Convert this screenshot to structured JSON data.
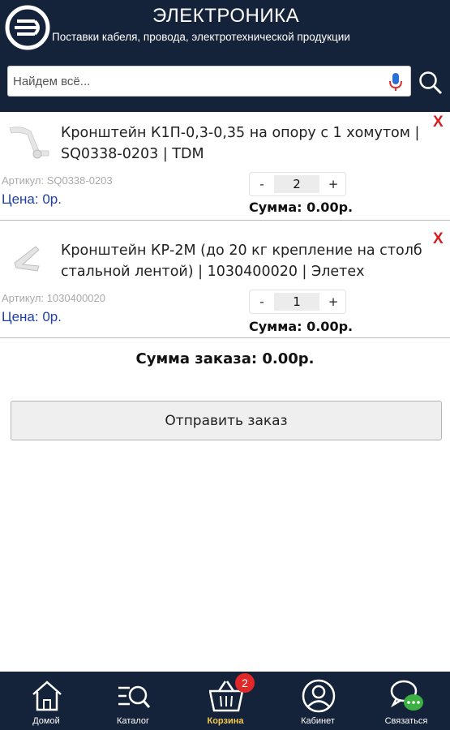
{
  "header": {
    "title": "ЭЛЕКТРОНИКА",
    "subtitle": "Поставки кабеля, провода, электротехнической продукции",
    "logo_icon": "logo-icon"
  },
  "search": {
    "placeholder": "Найдем всё...",
    "value": "",
    "mic_icon": "microphone-icon",
    "search_icon": "search-icon"
  },
  "cart": {
    "items": [
      {
        "name": "Кронштейн К1П-0,3-0,35 на опору с 1 хомутом | SQ0338-0203 | TDM",
        "sku": "Артикул: SQ0338-0203",
        "price": "Цена: 0р.",
        "qty_minus": "-",
        "qty": "2",
        "qty_plus": "+",
        "sum": "Сумма: 0.00р.",
        "remove": "X"
      },
      {
        "name": "Кронштейн КР-2М (до 20 кг крепление на столб стальной лентой) | 1030400020 | Элетех",
        "sku": "Артикул: 1030400020",
        "price": "Цена: 0р.",
        "qty_minus": "-",
        "qty": "1",
        "qty_plus": "+",
        "sum": "Сумма: 0.00р.",
        "remove": "X"
      }
    ],
    "order_total": "Сумма заказа: 0.00р.",
    "submit_label": "Отправить заказ"
  },
  "nav": {
    "items": [
      {
        "label": "Домой",
        "icon": "home-icon"
      },
      {
        "label": "Каталог",
        "icon": "catalog-search-icon"
      },
      {
        "label": "Корзина",
        "icon": "basket-icon",
        "active": true,
        "badge": "2"
      },
      {
        "label": "Кабинет",
        "icon": "user-icon"
      },
      {
        "label": "Связаться",
        "icon": "chat-icon"
      }
    ]
  },
  "colors": {
    "header_bg": "#15233a",
    "accent_active": "#f2c94c",
    "price_blue": "#1f3fa8",
    "remove_red": "#d42020",
    "badge_red": "#e02828"
  }
}
